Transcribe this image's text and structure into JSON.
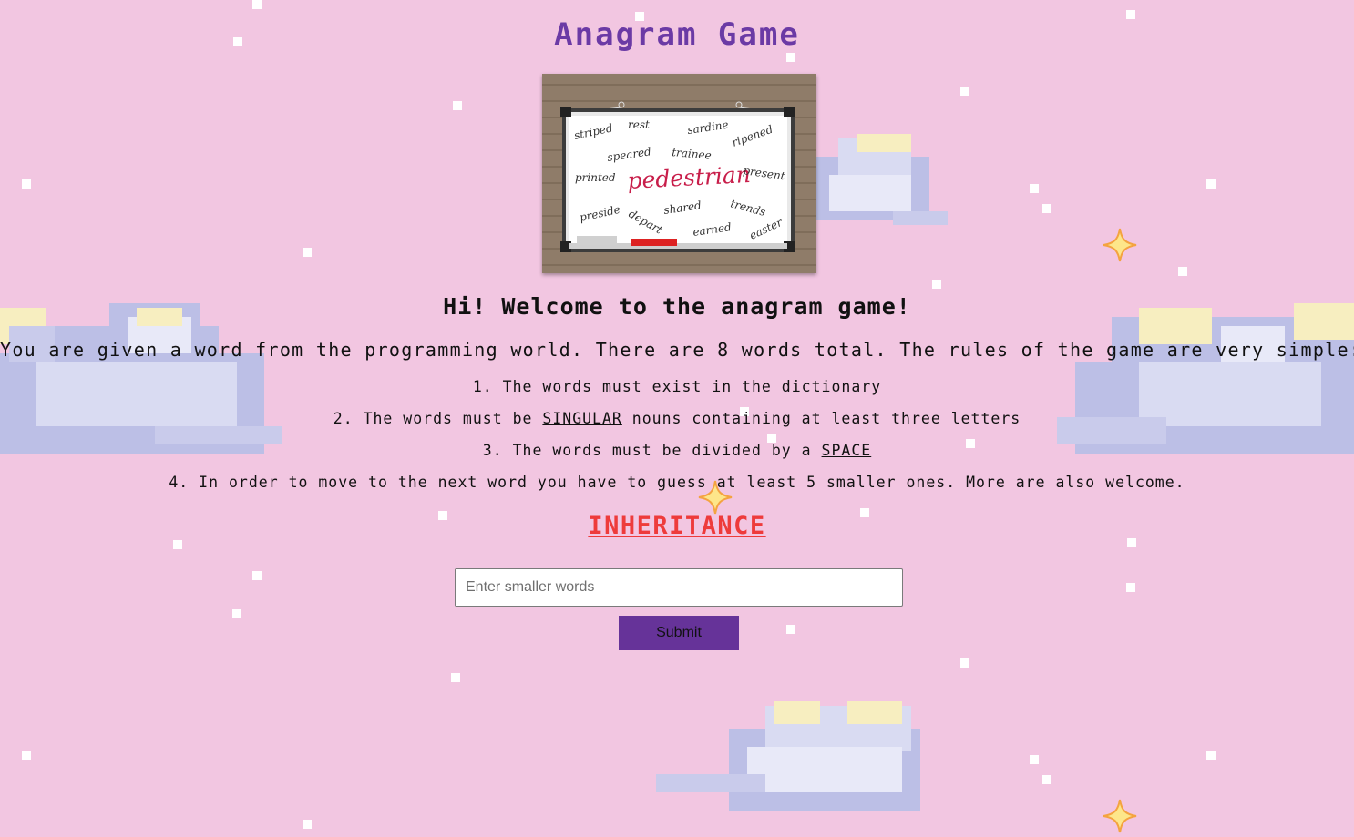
{
  "header": {
    "title": "Anagram Game"
  },
  "illustration": {
    "board_words": [
      "striped",
      "rest",
      "sardine",
      "ripened",
      "speared",
      "trainee",
      "printed",
      "pedestrian",
      "present",
      "preside",
      "depart",
      "shared",
      "trends",
      "earned",
      "easter"
    ]
  },
  "intro": {
    "welcome": "Hi! Welcome to the anagram game!",
    "description": "You are given a word from the programming world. There are 8 words total. The rules of the game are very simple:"
  },
  "rules": {
    "r1": "1. The words must exist in the dictionary",
    "r2_before": "2. The words must be ",
    "r2_emph": "SINGULAR",
    "r2_after": " nouns containing at least three letters",
    "r3_before": "3. The words must be divided by a ",
    "r3_emph": "SPACE",
    "r4": "4. In order to move to the next word you have to guess at least 5 smaller ones. More are also welcome."
  },
  "game": {
    "current_word": "INHERITANCE",
    "input_value": "",
    "input_placeholder": "Enter smaller words",
    "submit_label": "Submit"
  },
  "colors": {
    "background": "#f2c6e1",
    "title": "#6b3aa5",
    "current_word": "#ee3b3b",
    "button": "#663399"
  }
}
